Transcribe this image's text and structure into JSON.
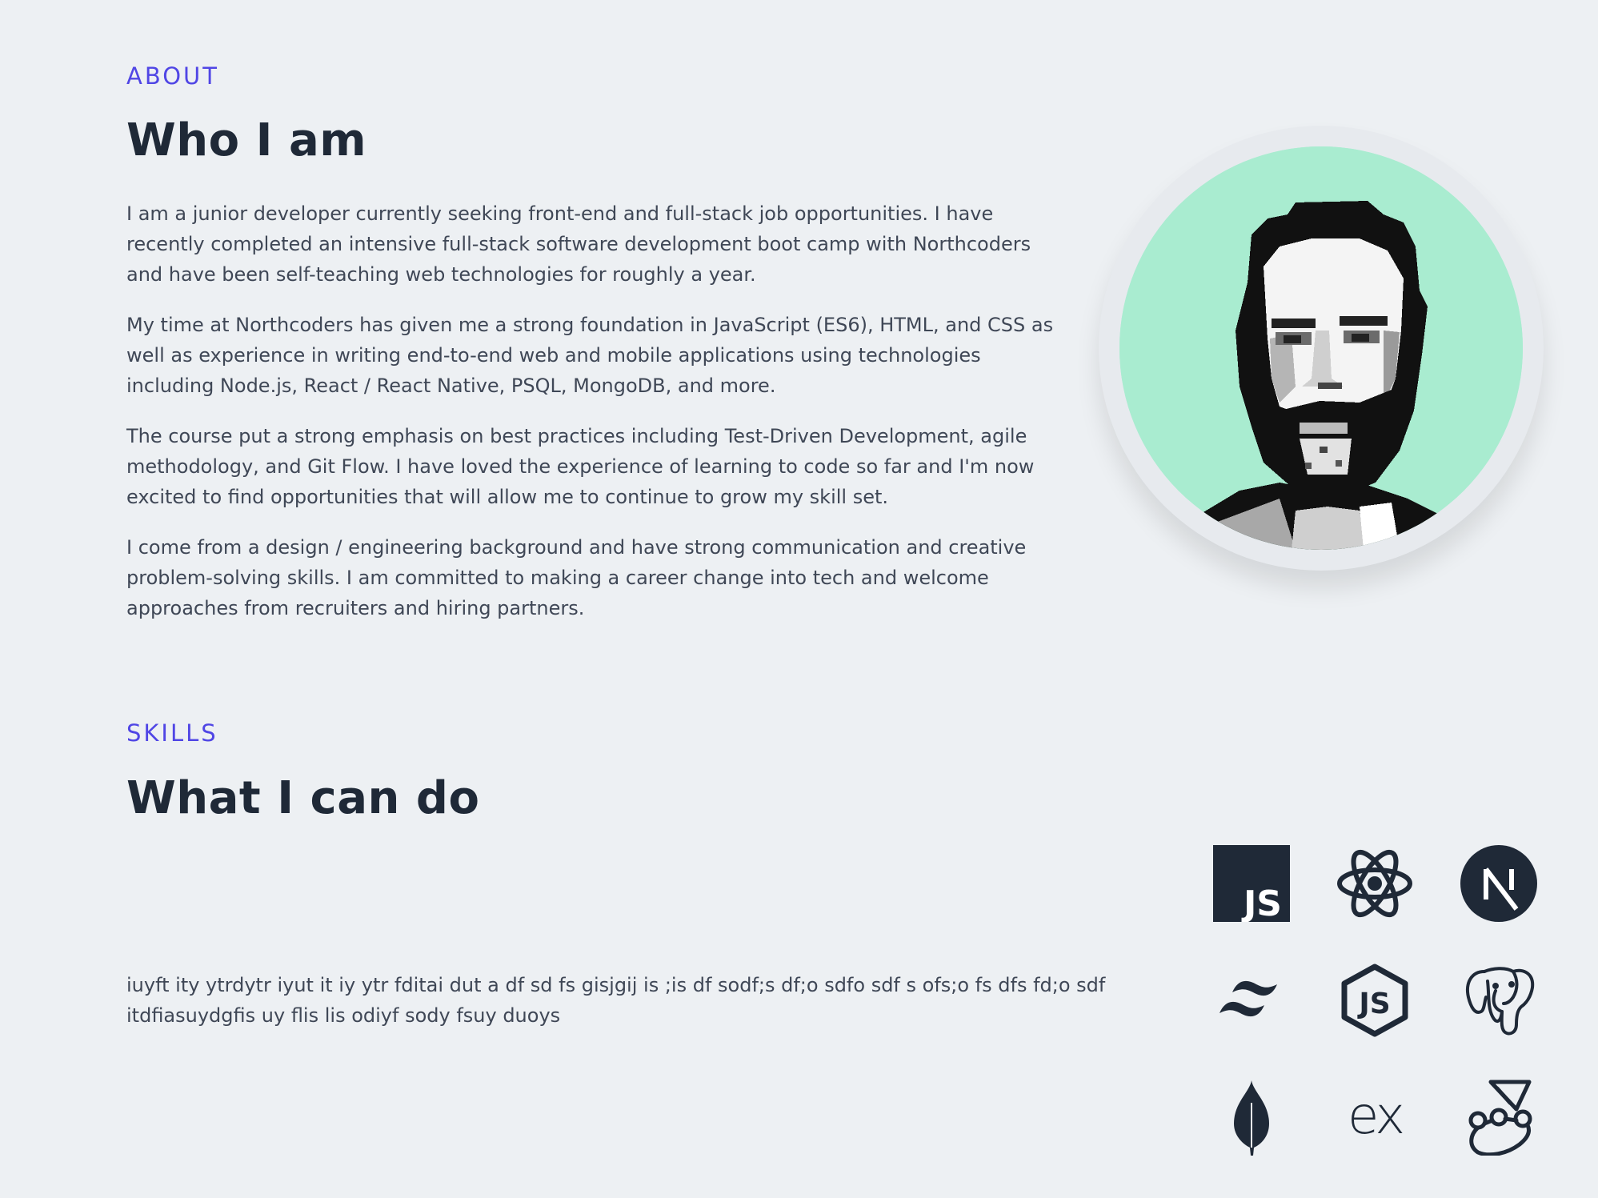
{
  "about": {
    "label": "ABOUT",
    "heading": "Who I am",
    "paragraphs": [
      "I am a junior developer currently seeking front-end and full-stack job opportunities. I have recently completed an intensive full-stack software development boot camp with Northcoders and have been self-teaching web technologies for roughly a year.",
      "My time at Northcoders has given me a strong foundation in JavaScript (ES6), HTML, and CSS as well as experience in writing end-to-end web and mobile applications using technologies including Node.js, React / React Native, PSQL, MongoDB, and more.",
      "The course put a strong emphasis on best practices including Test-Driven Development, agile methodology, and Git Flow. I have loved the experience of learning to code so far and I'm now excited to find opportunities that will allow me to continue to grow my skill set.",
      "I come from a design / engineering background and have strong communication and creative problem-solving skills. I am committed to making a career change into tech and welcome approaches from recruiters and hiring partners."
    ]
  },
  "avatar": {
    "icon": "pixel-portrait-avatar",
    "background_color": "#a9ecd0"
  },
  "skills": {
    "label": "SKILLS",
    "heading": "What I can do",
    "description": "iuyft ity ytrdytr iyut it iy ytr fditai dut a df sd fs gisjgij is ;is df sodf;s df;o sdfo sdf s ofs;o fs dfs fd;o sdf itdfiasuydgfis uy flis lis odiyf sody fsuy duoys",
    "icons": [
      "javascript-icon",
      "react-icon",
      "nextjs-icon",
      "tailwind-icon",
      "nodejs-icon",
      "postgresql-icon",
      "mongodb-icon",
      "express-icon",
      "jest-icon"
    ],
    "icon_labels": {
      "javascript": "JS",
      "nextjs": "N",
      "nodejs": "JS",
      "express": "ex"
    }
  },
  "colors": {
    "accent": "#5046e5",
    "heading": "#1f2937",
    "body_text": "#3f4756",
    "background": "#edf0f3",
    "icon": "#1f2937"
  }
}
